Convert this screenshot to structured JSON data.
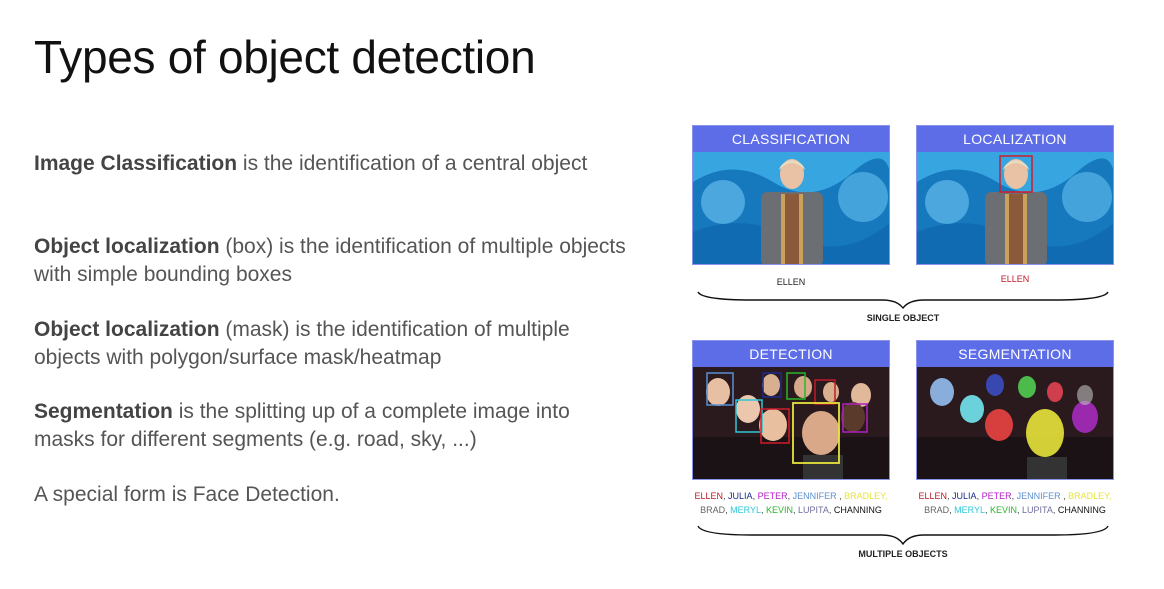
{
  "title": "Types of object detection",
  "paragraphs": [
    {
      "bold": "Image Classification",
      "rest": " is the identification of a central object"
    },
    {
      "bold": "Object localization",
      "rest": " (box) is the identification of multiple objects with simple bounding boxes"
    },
    {
      "bold": "Object localization",
      "rest": " (mask) is the identification of multiple objects with polygon/surface mask/heatmap"
    },
    {
      "bold": "Segmentation",
      "rest": " is the splitting up of a complete image into masks for different segments (e.g. road, sky, ...)"
    },
    {
      "bold": "",
      "rest": "A special form is Face Detection."
    }
  ],
  "figure": {
    "panels": {
      "classification": {
        "header": "CLASSIFICATION",
        "caption": "ELLEN"
      },
      "localization": {
        "header": "LOCALIZATION",
        "caption": "ELLEN"
      },
      "detection": {
        "header": "DETECTION"
      },
      "segmentation": {
        "header": "SEGMENTATION"
      }
    },
    "single_object_label": "SINGLE OBJECT",
    "multiple_objects_label": "MULTIPLE OBJECTS",
    "names": {
      "line1": [
        {
          "text": "ELLEN",
          "color": "#c0182b"
        },
        {
          "text": ", ",
          "color": "#444444"
        },
        {
          "text": "JULIA",
          "color": "#1c2a8c"
        },
        {
          "text": ", ",
          "color": "#444444"
        },
        {
          "text": "PETER",
          "color": "#b01fc2"
        },
        {
          "text": ", ",
          "color": "#444444"
        },
        {
          "text": "JENNIFER",
          "color": "#5a8fd0"
        },
        {
          "text": " , ",
          "color": "#444444"
        },
        {
          "text": "BRADLEY,",
          "color": "#e8e43a"
        }
      ],
      "line2": [
        {
          "text": "BRAD",
          "color": "#666666"
        },
        {
          "text": ", ",
          "color": "#444444"
        },
        {
          "text": "MERYL",
          "color": "#2cc7d6"
        },
        {
          "text": ", ",
          "color": "#444444"
        },
        {
          "text": "KEVIN",
          "color": "#2bb52b"
        },
        {
          "text": ", ",
          "color": "#444444"
        },
        {
          "text": "LUPITA",
          "color": "#6e6e9e"
        },
        {
          "text": ", ",
          "color": "#444444"
        },
        {
          "text": "CHANNING",
          "color": "#111111"
        }
      ]
    },
    "colors": {
      "header_bg": "#5d6de8",
      "localization_caption": "#c0182b"
    }
  }
}
